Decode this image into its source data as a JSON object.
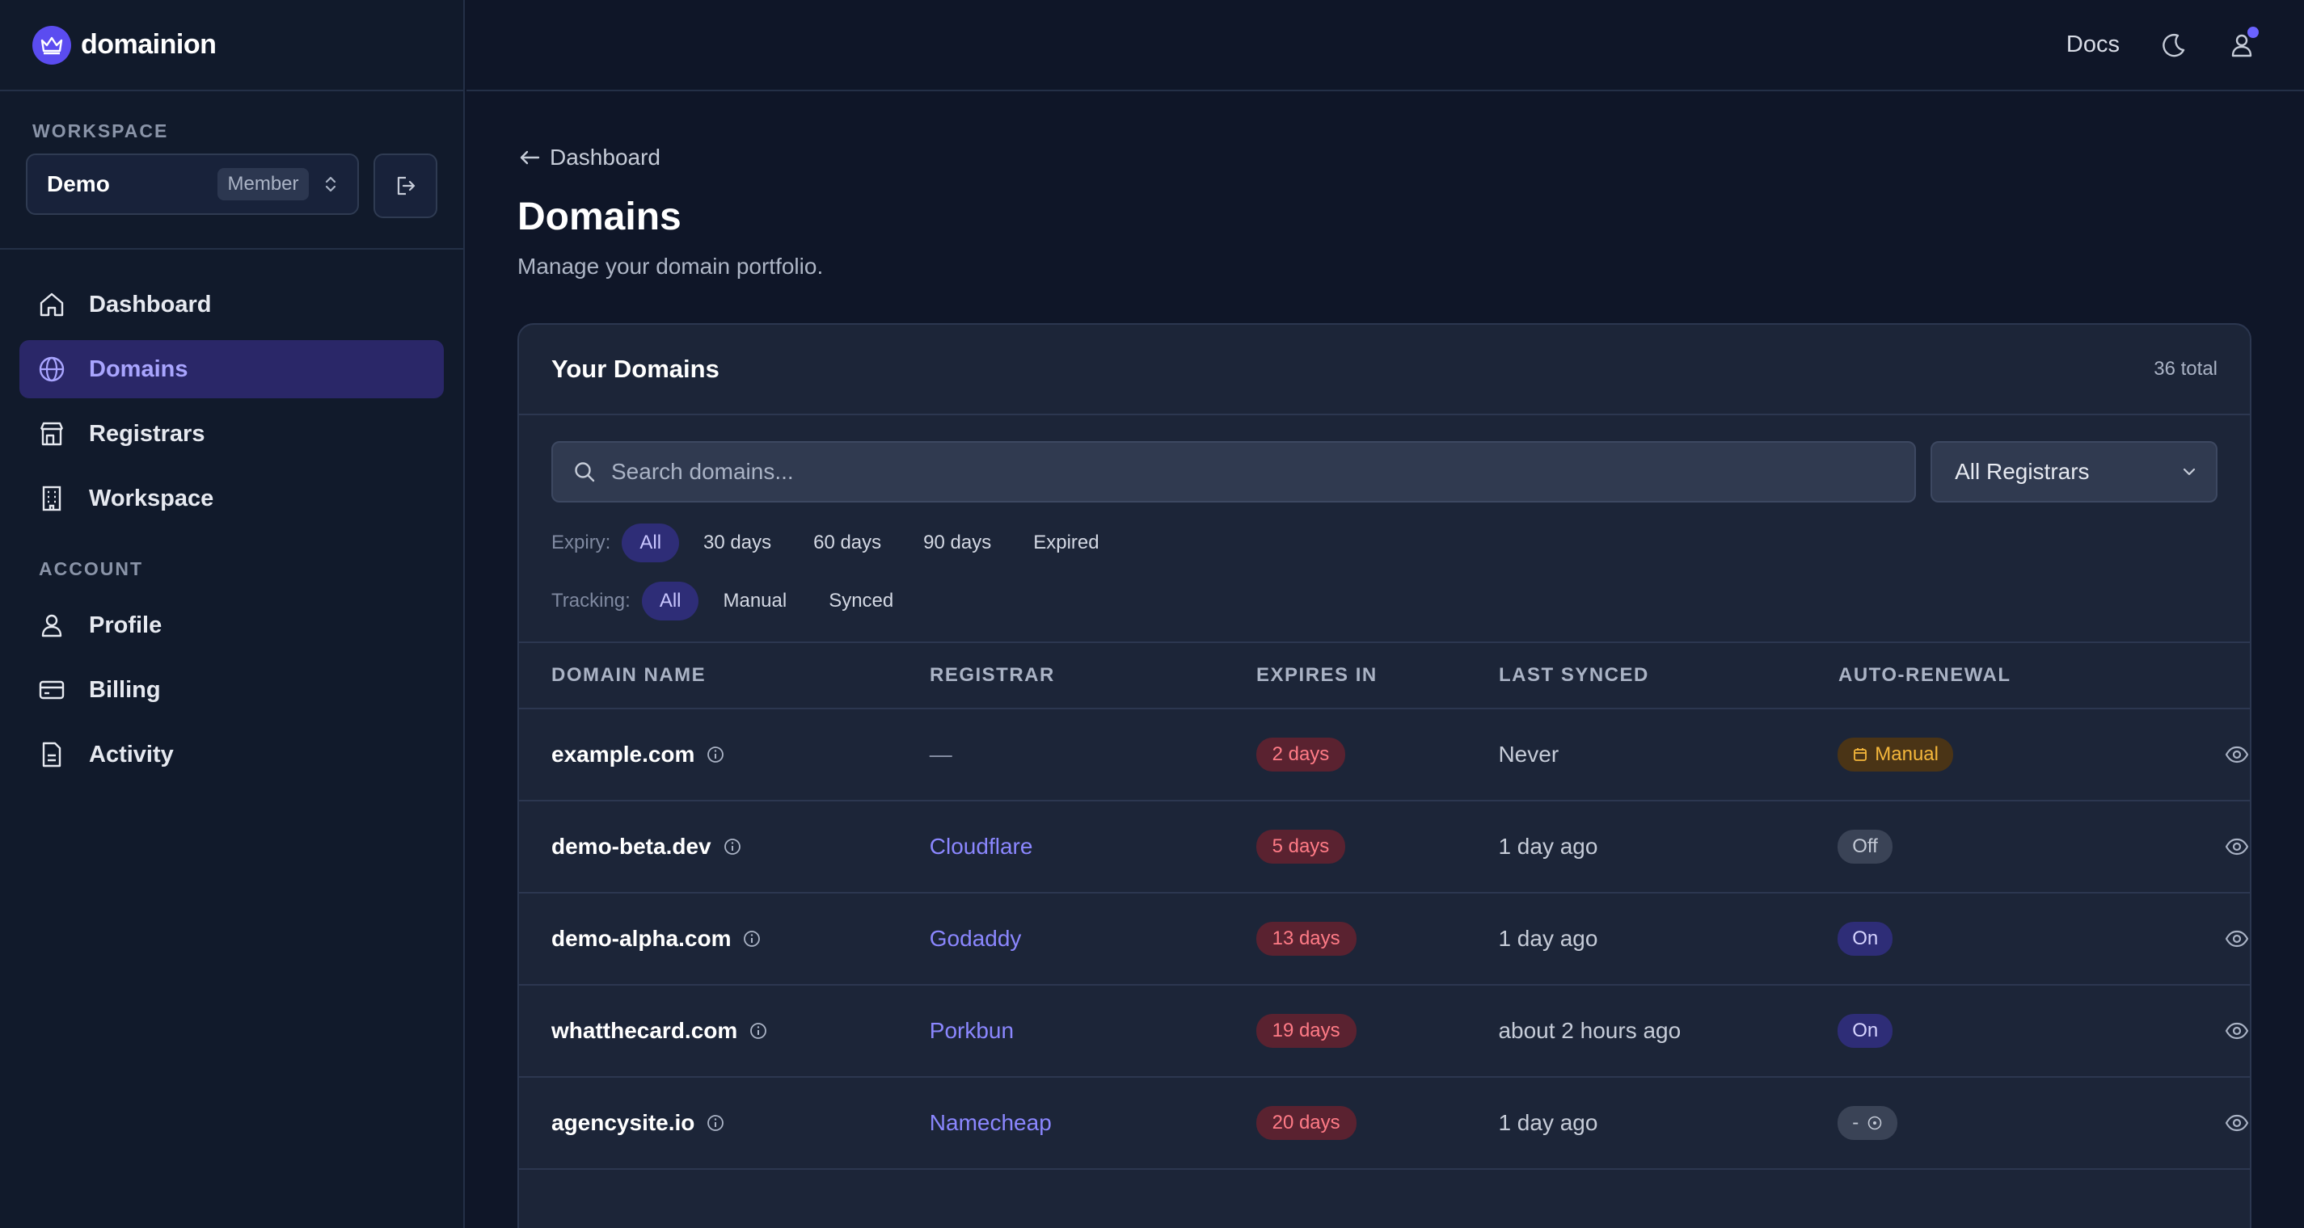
{
  "app": {
    "name": "domainion"
  },
  "header": {
    "docs_label": "Docs"
  },
  "sidebar": {
    "workspace_label": "WORKSPACE",
    "workspace_name": "Demo",
    "workspace_role": "Member",
    "nav": [
      {
        "label": "Dashboard",
        "icon": "home-icon"
      },
      {
        "label": "Domains",
        "icon": "globe-icon",
        "active": true
      },
      {
        "label": "Registrars",
        "icon": "store-icon"
      },
      {
        "label": "Workspace",
        "icon": "building-icon"
      }
    ],
    "account_label": "ACCOUNT",
    "account_nav": [
      {
        "label": "Profile",
        "icon": "user-icon"
      },
      {
        "label": "Billing",
        "icon": "credit-card-icon"
      },
      {
        "label": "Activity",
        "icon": "document-icon"
      }
    ]
  },
  "main": {
    "back_label": "Dashboard",
    "title": "Domains",
    "subtitle": "Manage your domain portfolio.",
    "card": {
      "title": "Your Domains",
      "count": "36 total",
      "search_placeholder": "Search domains...",
      "registrar_filter": "All Registrars",
      "expiry_label": "Expiry:",
      "expiry_options": [
        "All",
        "30 days",
        "60 days",
        "90 days",
        "Expired"
      ],
      "tracking_label": "Tracking:",
      "tracking_options": [
        "All",
        "Manual",
        "Synced"
      ],
      "columns": [
        "DOMAIN NAME",
        "REGISTRAR",
        "EXPIRES IN",
        "LAST SYNCED",
        "AUTO-RENEWAL"
      ],
      "rows": [
        {
          "domain": "example.com",
          "registrar": "—",
          "expires": "2 days",
          "synced": "Never",
          "auto": "Manual"
        },
        {
          "domain": "demo-beta.dev",
          "registrar": "Cloudflare",
          "expires": "5 days",
          "synced": "1 day ago",
          "auto": "Off"
        },
        {
          "domain": "demo-alpha.com",
          "registrar": "Godaddy",
          "expires": "13 days",
          "synced": "1 day ago",
          "auto": "On"
        },
        {
          "domain": "whatthecard.com",
          "registrar": "Porkbun",
          "expires": "19 days",
          "synced": "about 2 hours ago",
          "auto": "On"
        },
        {
          "domain": "agencysite.io",
          "registrar": "Namecheap",
          "expires": "20 days",
          "synced": "1 day ago",
          "auto": "-"
        }
      ]
    }
  },
  "colors": {
    "accent": "#5b4cf0",
    "danger": "#ff7b86",
    "warning": "#f5b73b",
    "link": "#8b87ff"
  }
}
